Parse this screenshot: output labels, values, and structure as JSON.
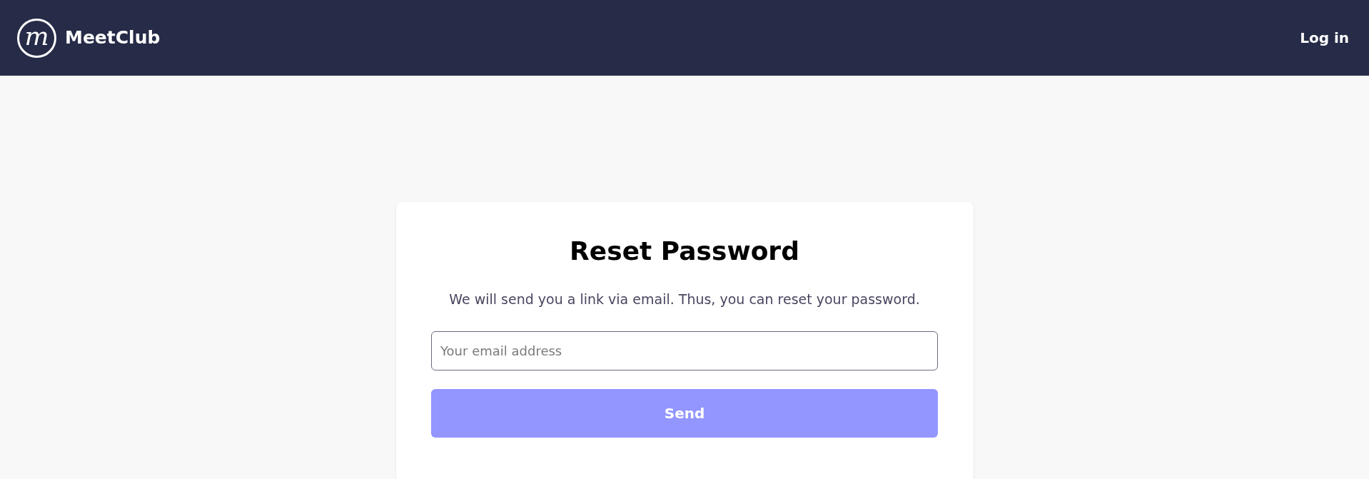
{
  "header": {
    "logo_mark": "m",
    "brand": "MeetClub",
    "login": "Log in"
  },
  "card": {
    "title": "Reset Password",
    "description": "We will send you a link via email. Thus, you can reset your password.",
    "email": {
      "placeholder": "Your email address"
    },
    "submit": {
      "label": "Send",
      "disabled": true
    }
  }
}
